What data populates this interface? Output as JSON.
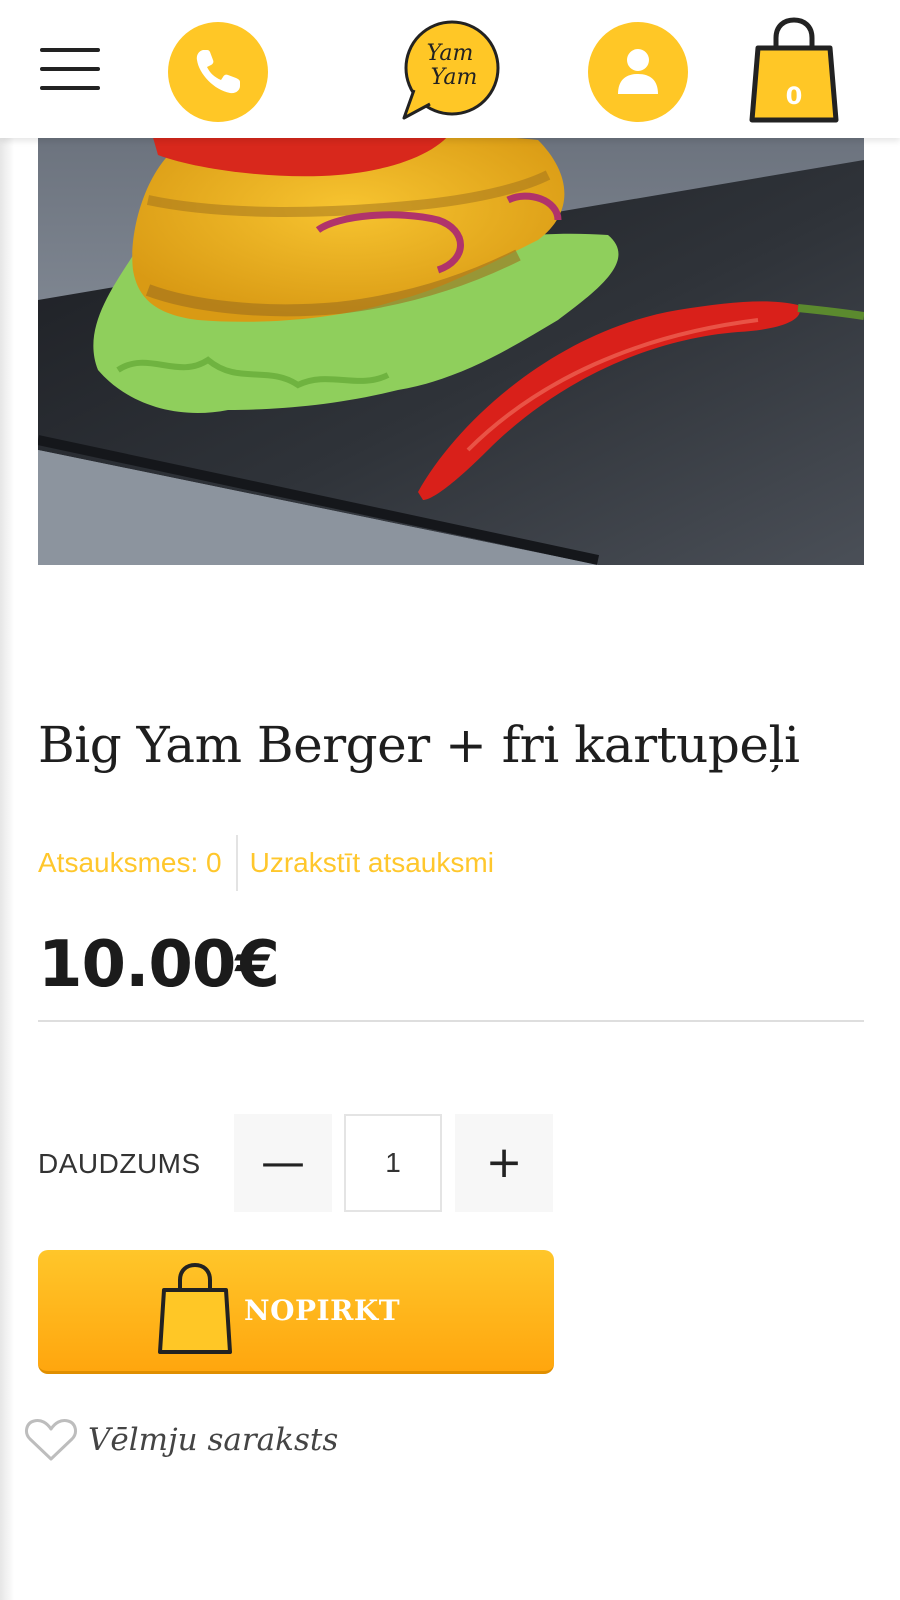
{
  "header": {
    "menu_icon": "hamburger-menu-icon",
    "phone_icon": "phone-icon",
    "logo_text": "Yam Yam",
    "account_icon": "user-icon",
    "cart_icon": "shopping-bag-icon",
    "cart_count": "0"
  },
  "product": {
    "image_alt": "burger with lettuce, cheese, onion and red chili pepper",
    "title": "Big Yam Berger + fri kartupeļi",
    "reviews_label": "Atsauksmes: 0",
    "write_review_label": "Uzrakstīt atsauksmi",
    "price": "10.00€"
  },
  "quantity": {
    "label": "DAUDZUMS",
    "minus": "—",
    "value": "1",
    "plus": "+"
  },
  "buy_button": {
    "label": "NOPIRKT",
    "icon": "shopping-bag-icon"
  },
  "wishlist": {
    "label": "Vēlmju saraksts",
    "icon": "heart-outline-icon"
  },
  "colors": {
    "accent_yellow": "#ffc726",
    "button_orange": "#ffa60e",
    "review_link": "#ffc72c"
  }
}
